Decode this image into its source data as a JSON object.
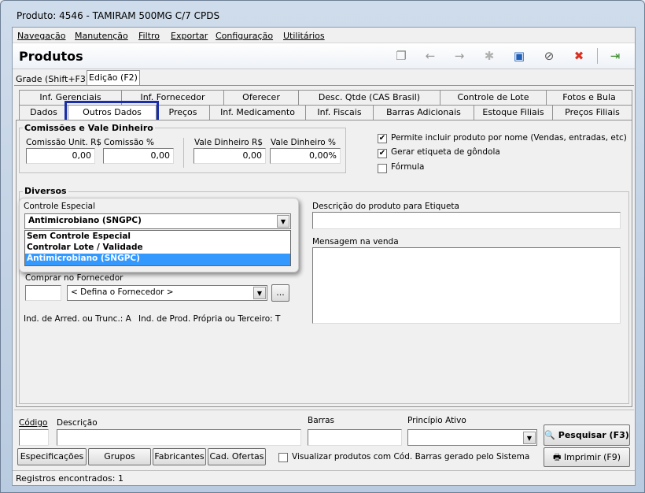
{
  "window": {
    "title": "Produto: 4546 - TAMIRAM 500MG C/7 CPDS"
  },
  "menu": [
    "Navegação",
    "Manutenção",
    "Filtro",
    "Exportar",
    "Configuração",
    "Utilitários"
  ],
  "toolbar": {
    "title": "Produtos",
    "icons": [
      "copy-icon",
      "arrow-left-icon",
      "arrow-right-icon",
      "new-icon",
      "save-icon",
      "cancel-icon",
      "delete-icon",
      "exit-icon"
    ]
  },
  "mode_tabs": [
    "Grade (Shift+F3)",
    "Edição (F2)"
  ],
  "tabs_row1": [
    "Inf. Gerenciais",
    "Inf. Fornecedor",
    "Oferecer",
    "Desc. Qtde (CAS Brasil)",
    "Controle de Lote",
    "Fotos e Bula"
  ],
  "tabs_row2": [
    "Dados",
    "Outros Dados",
    "Preços",
    "Inf. Medicamento",
    "Inf. Fiscais",
    "Barras Adicionais",
    "Estoque Filiais",
    "Preços Filiais"
  ],
  "comissoes": {
    "title": "Comissões e Vale Dinheiro",
    "labels": [
      "Comissão Unit. R$",
      "Comissão %",
      "Vale Dinheiro R$",
      "Vale Dinheiro %"
    ],
    "values": [
      "0,00",
      "0,00",
      "0,00",
      "0,00%"
    ]
  },
  "checks": [
    {
      "label": "Permite incluir produto por nome (Vendas, entradas, etc)",
      "checked": true
    },
    {
      "label": "Gerar etiqueta de gôndola",
      "checked": true
    },
    {
      "label": "Fórmula",
      "checked": false
    }
  ],
  "diversos": {
    "title": "Diversos",
    "controle_label": "Controle Especial",
    "controle_value": "Antimicrobiano (SNGPC)",
    "options": [
      "Sem Controle Especial",
      "Controlar Lote / Validade",
      "Antimicrobiano (SNGPC)"
    ],
    "selected_index": 2,
    "fornecedor_label": "Comprar no Fornecedor",
    "fornecedor_value": "< Defina o Fornecedor >",
    "ellipsis": "...",
    "arred": "Ind. de Arred. ou Trunc.: A",
    "prod_propria": "Ind. de Prod. Própria ou Terceiro: T",
    "etiqueta_label": "Descrição do produto para Etiqueta",
    "mensagem_label": "Mensagem na venda"
  },
  "search": {
    "codigo": "Código",
    "descricao": "Descrição",
    "barras": "Barras",
    "principio": "Princípio Ativo",
    "pesquisar": "Pesquisar (F3)",
    "imprimir": "Imprimir (F9)"
  },
  "bottom_buttons": [
    "Especificações",
    "Grupos",
    "Fabricantes",
    "Cad. Ofertas"
  ],
  "visualizar": "Visualizar produtos com Cód. Barras gerado pelo Sistema",
  "status": "Registros encontrados: 1",
  "colors": {
    "highlight": "#3399ff",
    "active_tab_border": "#1a2fa8"
  }
}
